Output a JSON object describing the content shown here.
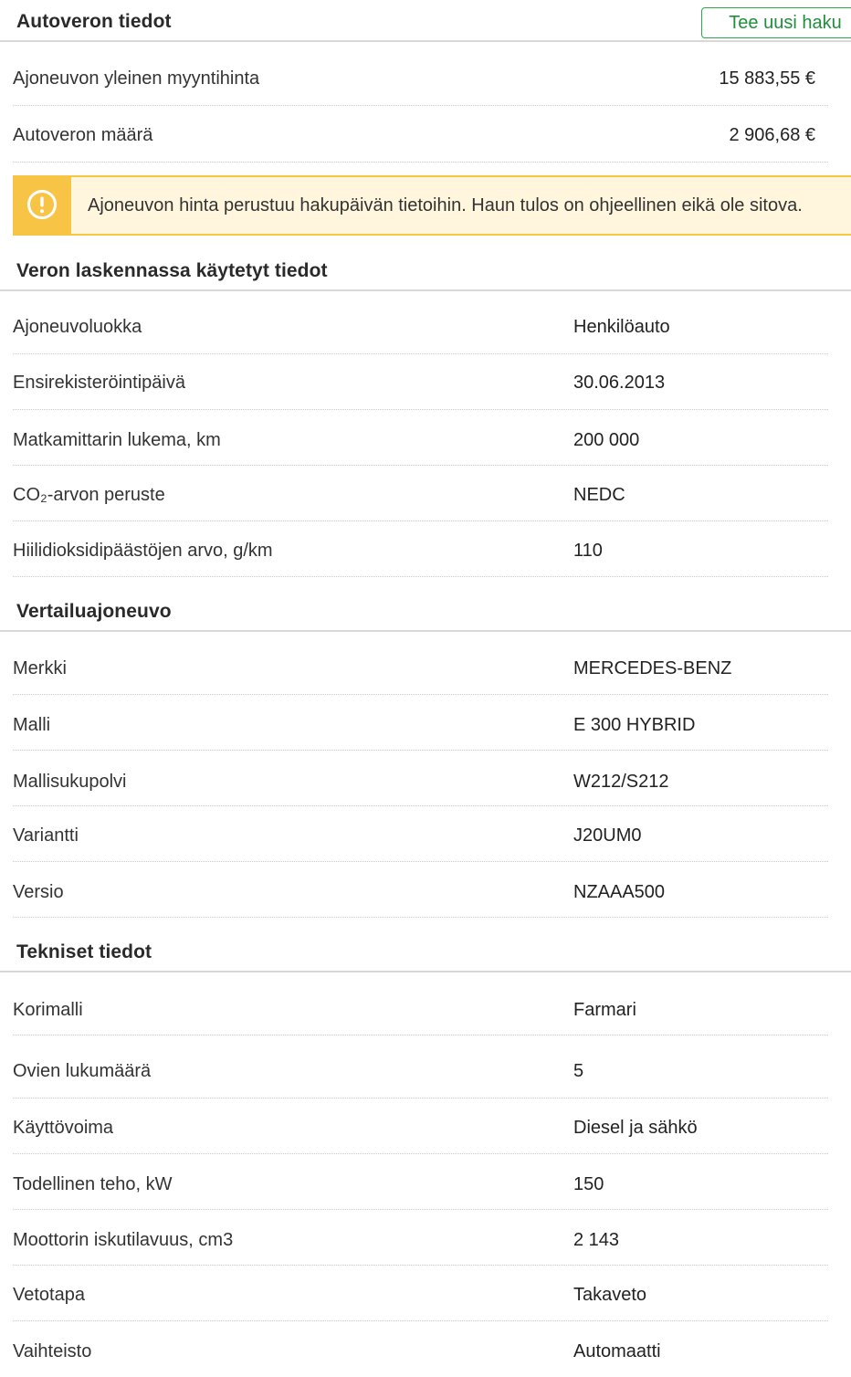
{
  "summary": {
    "title": "Autoveron tiedot",
    "new_search_label": "Tee uusi haku",
    "rows": [
      {
        "label": "Ajoneuvon yleinen myyntihinta",
        "value": "15 883,55  €"
      },
      {
        "label": "Autoveron määrä",
        "value": "2 906,68  €"
      }
    ]
  },
  "notice": {
    "icon": "exclamation-circle-icon",
    "text": "Ajoneuvon hinta perustuu hakupäivän tietoihin. Haun tulos on ohjeellinen eikä ole sitova.",
    "accent_color": "#f8c445",
    "background_color": "#fff6dd"
  },
  "tax_basis": {
    "title": "Veron laskennassa käytetyt tiedot",
    "rows": [
      {
        "label": "Ajoneuvoluokka",
        "value": "Henkilöauto"
      },
      {
        "label": "Ensirekisteröintipäivä",
        "value": "30.06.2013"
      },
      {
        "label": "Matkamittarin lukema, km",
        "value": "200 000"
      },
      {
        "label": "CO₂-arvon peruste",
        "value": "NEDC"
      },
      {
        "label": "Hiilidioksidipäästöjen arvo, g/km",
        "value": "110"
      }
    ]
  },
  "comparison_vehicle": {
    "title": "Vertailuajoneuvo",
    "rows": [
      {
        "label": "Merkki",
        "value": "MERCEDES-BENZ"
      },
      {
        "label": "Malli",
        "value": "E 300 HYBRID"
      },
      {
        "label": "Mallisukupolvi",
        "value": "W212/S212"
      },
      {
        "label": "Variantti",
        "value": "J20UM0"
      },
      {
        "label": "Versio",
        "value": "NZAAA500"
      }
    ]
  },
  "technical": {
    "title": "Tekniset tiedot",
    "rows": [
      {
        "label": "Korimalli",
        "value": "Farmari"
      },
      {
        "label": "Ovien lukumäärä",
        "value": "5"
      },
      {
        "label": "Käyttövoima",
        "value": "Diesel ja sähkö"
      },
      {
        "label": "Todellinen teho, kW",
        "value": "150"
      },
      {
        "label": "Moottorin iskutilavuus, cm3",
        "value": "2 143"
      },
      {
        "label": "Vetotapa",
        "value": "Takaveto"
      },
      {
        "label": "Vaihteisto",
        "value": "Automaatti"
      }
    ]
  },
  "colors": {
    "button_border": "#2ea84a",
    "button_text": "#1f8f3b"
  }
}
